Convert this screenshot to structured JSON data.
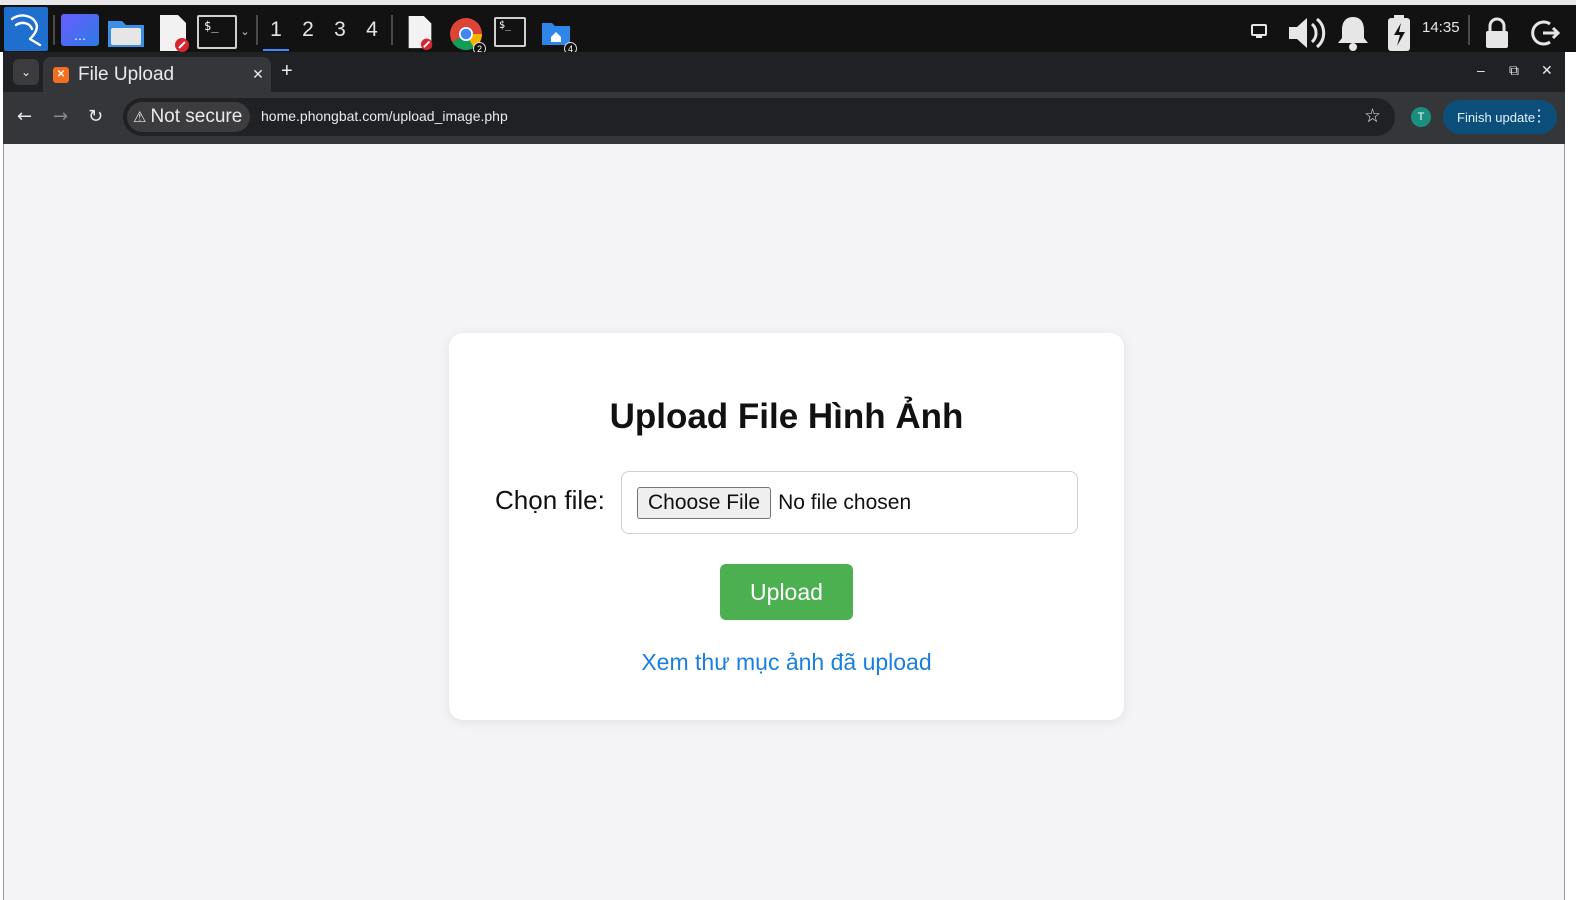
{
  "taskbar": {
    "workspaces": [
      "1",
      "2",
      "3",
      "4"
    ],
    "chrome_badge": "2",
    "files_badge": "4",
    "clock": "14:35"
  },
  "browser": {
    "tab_title": "File Upload",
    "new_tab": "+",
    "security_chip": "Not secure",
    "url": "home.phongbat.com/upload_image.php",
    "profile_initial": "T",
    "finish_update_label": "Finish update"
  },
  "page": {
    "title": "Upload File Hình Ảnh",
    "file_label": "Chọn file:",
    "choose_file_label": "Choose File",
    "no_file_text": "No file chosen",
    "upload_label": "Upload",
    "view_link": "Xem thư mục ảnh đã upload"
  },
  "colors": {
    "upload_button": "#4caf50",
    "link": "#1a7fe0",
    "page_background": "#f4f4f7",
    "update_button": "#0b4f7a"
  }
}
